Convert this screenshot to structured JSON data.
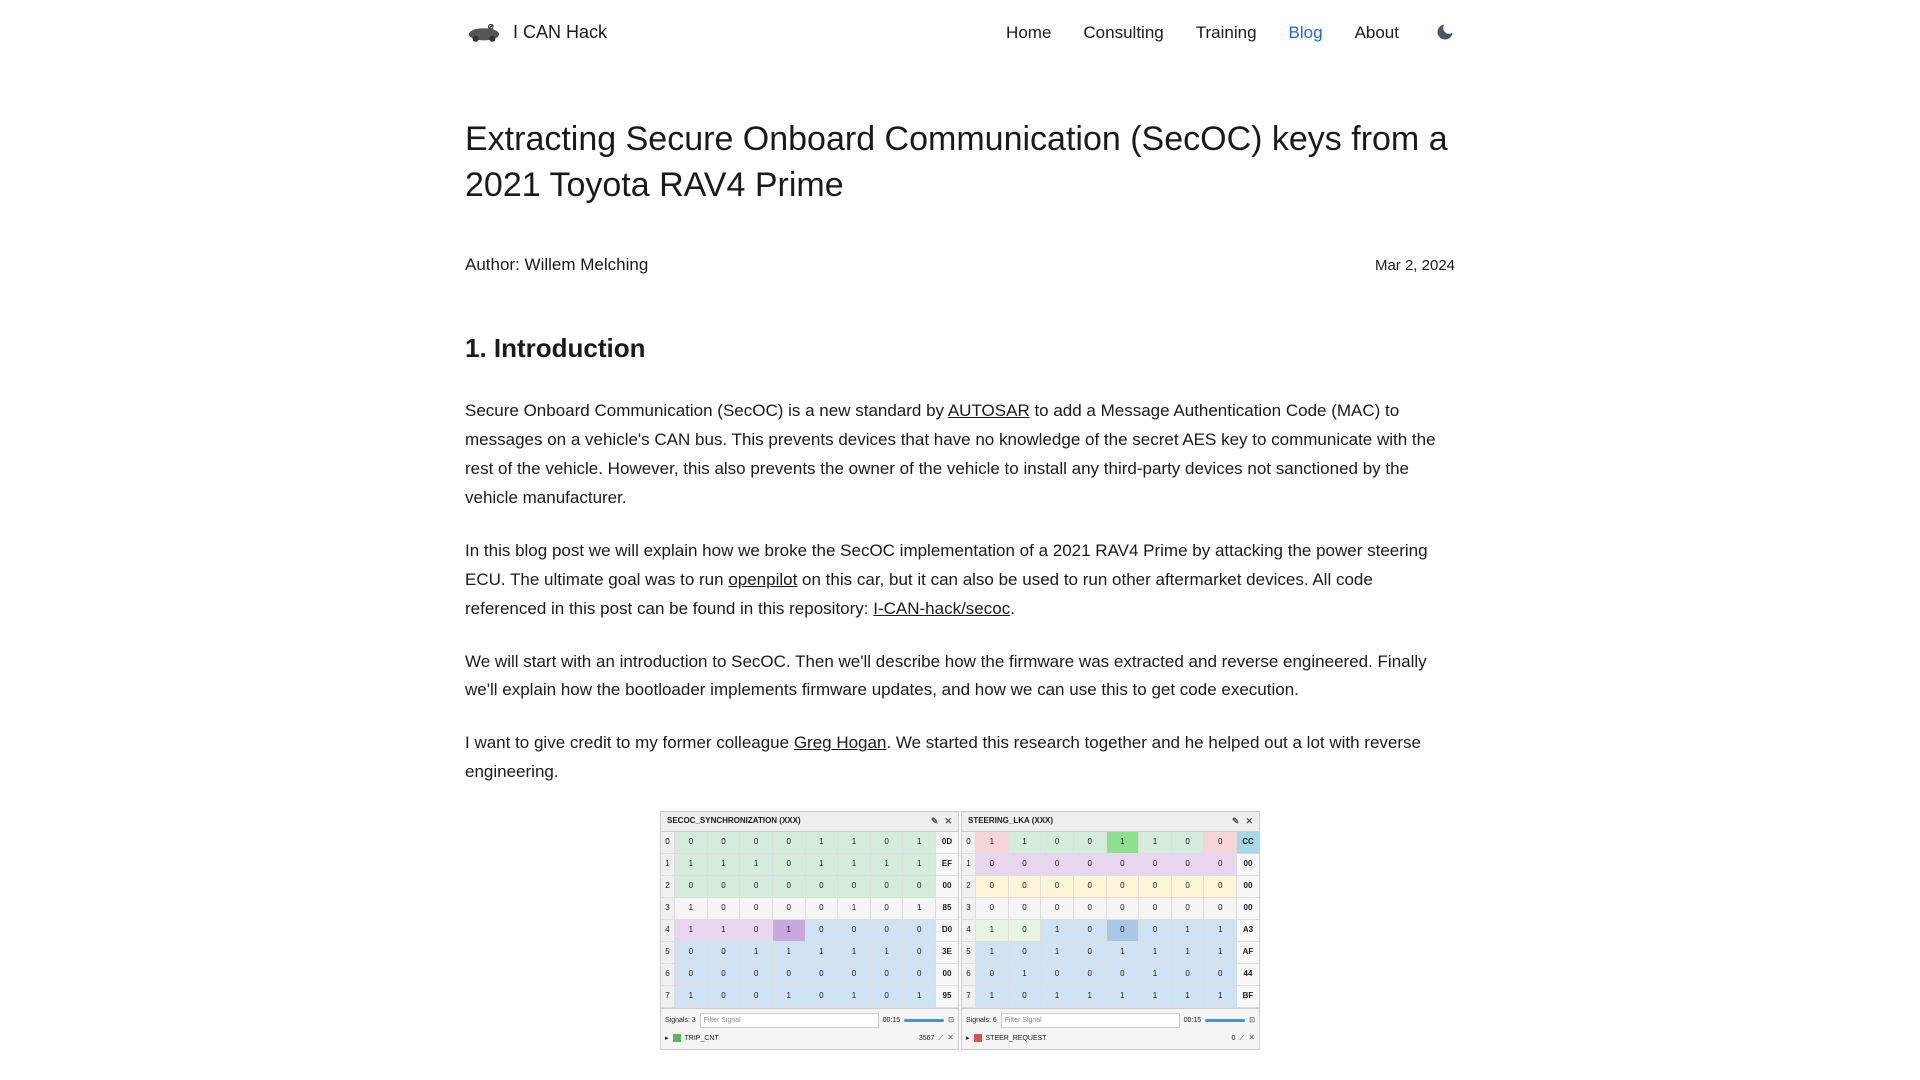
{
  "brand": "I CAN Hack",
  "nav": {
    "home": "Home",
    "consulting": "Consulting",
    "training": "Training",
    "blog": "Blog",
    "about": "About"
  },
  "article": {
    "title": "Extracting Secure Onboard Communication (SecOC) keys from a 2021 Toyota RAV4 Prime",
    "author_label": "Author:",
    "author_name": "Willem Melching",
    "date": "Mar 2, 2024",
    "h2": "1. Introduction",
    "p1a": "Secure Onboard Communication (SecOC) is a new standard by ",
    "p1_link1": "AUTOSAR",
    "p1b": " to add a Message Authentication Code (MAC) to messages on a vehicle's CAN bus. This prevents devices that have no knowledge of the secret AES key to communicate with the rest of the vehicle. However, this also prevents the owner of the vehicle to install any third-party devices not sanctioned by the vehicle manufacturer.",
    "p2a": "In this blog post we will explain how we broke the SecOC implementation of a 2021 RAV4 Prime by attacking the power steering ECU. The ultimate goal was to run ",
    "p2_link1": "openpilot",
    "p2b": " on this car, but it can also be used to run other aftermarket devices. All code referenced in this post can be found in this repository: ",
    "p2_link2": "I-CAN-hack/secoc",
    "p2c": ".",
    "p3": "We will start with an introduction to SecOC. Then we'll describe how the firmware was extracted and reverse engineered. Finally we'll explain how the bootloader implements firmware updates, and how we can use this to get code execution.",
    "p4a": "I want to give credit to my former colleague ",
    "p4_link1": "Greg Hogan",
    "p4b": ". We started this research together and he helped out a lot with reverse engineering."
  },
  "fig": {
    "panel1": {
      "title": "SECOC_SYNCHRONIZATION (XXX)",
      "rows": [
        {
          "idx": "0",
          "bits": [
            "0",
            "0",
            "0",
            "0",
            "1",
            "1",
            "0",
            "1"
          ],
          "hex": "0D",
          "cls": [
            "bg-green",
            "bg-green",
            "bg-green",
            "bg-green",
            "bg-green",
            "bg-green",
            "bg-green",
            "bg-green"
          ]
        },
        {
          "idx": "1",
          "bits": [
            "1",
            "1",
            "1",
            "0",
            "1",
            "1",
            "1",
            "1"
          ],
          "hex": "EF",
          "cls": [
            "bg-green",
            "bg-green",
            "bg-green",
            "bg-green",
            "bg-green",
            "bg-green",
            "bg-green",
            "bg-green"
          ]
        },
        {
          "idx": "2",
          "bits": [
            "0",
            "0",
            "0",
            "0",
            "0",
            "0",
            "0",
            "0"
          ],
          "hex": "00",
          "cls": [
            "bg-green",
            "bg-green",
            "bg-green",
            "bg-green",
            "bg-green",
            "bg-green",
            "bg-green",
            "bg-green"
          ]
        },
        {
          "idx": "3",
          "bits": [
            "1",
            "0",
            "0",
            "0",
            "0",
            "1",
            "0",
            "1"
          ],
          "hex": "85",
          "cls": [
            "",
            "",
            "",
            "",
            "",
            "",
            "",
            ""
          ]
        },
        {
          "idx": "4",
          "bits": [
            "1",
            "1",
            "0",
            "1",
            "0",
            "0",
            "0",
            "0"
          ],
          "hex": "D0",
          "cls": [
            "bg-purple",
            "bg-purple",
            "bg-purple",
            "bg-purple-bright",
            "bg-blue",
            "bg-blue",
            "bg-blue",
            "bg-blue"
          ]
        },
        {
          "idx": "5",
          "bits": [
            "0",
            "0",
            "1",
            "1",
            "1",
            "1",
            "1",
            "0"
          ],
          "hex": "3E",
          "cls": [
            "bg-blue",
            "bg-blue",
            "bg-blue",
            "bg-blue",
            "bg-blue",
            "bg-blue",
            "bg-blue",
            "bg-blue"
          ]
        },
        {
          "idx": "6",
          "bits": [
            "0",
            "0",
            "0",
            "0",
            "0",
            "0",
            "0",
            "0"
          ],
          "hex": "00",
          "cls": [
            "bg-blue",
            "bg-blue",
            "bg-blue",
            "bg-blue",
            "bg-blue",
            "bg-blue",
            "bg-blue",
            "bg-blue"
          ]
        },
        {
          "idx": "7",
          "bits": [
            "1",
            "0",
            "0",
            "1",
            "0",
            "1",
            "0",
            "1"
          ],
          "hex": "95",
          "cls": [
            "bg-blue",
            "bg-blue",
            "bg-blue",
            "bg-blue",
            "bg-blue",
            "bg-blue",
            "bg-blue",
            "bg-blue"
          ]
        }
      ],
      "signals_label": "Signals: 3",
      "filter_placeholder": "Filter Signal",
      "time": "00:15",
      "sig_name": "TRIP_CNT",
      "sig_val": "3567"
    },
    "panel2": {
      "title": "STEERING_LKA (XXX)",
      "rows": [
        {
          "idx": "0",
          "bits": [
            "1",
            "1",
            "0",
            "0",
            "1",
            "1",
            "0",
            "0"
          ],
          "hex": "CC",
          "cls": [
            "bg-pink",
            "bg-green",
            "bg-green",
            "bg-green",
            "bg-green-bright",
            "bg-green",
            "bg-green",
            "bg-pink"
          ],
          "hexcls": "bg-cyan"
        },
        {
          "idx": "1",
          "bits": [
            "0",
            "0",
            "0",
            "0",
            "0",
            "0",
            "0",
            "0"
          ],
          "hex": "00",
          "cls": [
            "bg-purple",
            "bg-purple",
            "bg-purple",
            "bg-purple",
            "bg-purple",
            "bg-purple",
            "bg-purple",
            "bg-purple"
          ]
        },
        {
          "idx": "2",
          "bits": [
            "0",
            "0",
            "0",
            "0",
            "0",
            "0",
            "0",
            "0"
          ],
          "hex": "00",
          "cls": [
            "bg-yellow",
            "bg-yellow",
            "bg-yellow",
            "bg-yellow",
            "bg-yellow",
            "bg-yellow",
            "bg-yellow",
            "bg-yellow"
          ]
        },
        {
          "idx": "3",
          "bits": [
            "0",
            "0",
            "0",
            "0",
            "0",
            "0",
            "0",
            "0"
          ],
          "hex": "00",
          "cls": [
            "",
            "",
            "",
            "",
            "",
            "",
            "",
            ""
          ]
        },
        {
          "idx": "4",
          "bits": [
            "1",
            "0",
            "1",
            "0",
            "0",
            "0",
            "1",
            "1"
          ],
          "hex": "A3",
          "cls": [
            "bg-pale-green",
            "bg-pale-green",
            "bg-blue",
            "bg-blue",
            "bg-blue-bright",
            "bg-blue",
            "bg-blue",
            "bg-blue"
          ]
        },
        {
          "idx": "5",
          "bits": [
            "1",
            "0",
            "1",
            "0",
            "1",
            "1",
            "1",
            "1"
          ],
          "hex": "AF",
          "cls": [
            "bg-blue",
            "bg-blue",
            "bg-blue",
            "bg-blue",
            "bg-blue",
            "bg-blue",
            "bg-blue",
            "bg-blue"
          ]
        },
        {
          "idx": "6",
          "bits": [
            "0",
            "1",
            "0",
            "0",
            "0",
            "1",
            "0",
            "0"
          ],
          "hex": "44",
          "cls": [
            "bg-blue",
            "bg-blue",
            "bg-blue",
            "bg-blue",
            "bg-blue",
            "bg-blue",
            "bg-blue",
            "bg-blue"
          ]
        },
        {
          "idx": "7",
          "bits": [
            "1",
            "0",
            "1",
            "1",
            "1",
            "1",
            "1",
            "1"
          ],
          "hex": "BF",
          "cls": [
            "bg-blue",
            "bg-blue",
            "bg-blue",
            "bg-blue",
            "bg-blue",
            "bg-blue",
            "bg-blue",
            "bg-blue"
          ]
        }
      ],
      "signals_label": "Signals: 6",
      "filter_placeholder": "Filter Signal",
      "time": "00:15",
      "sig_name": "STEER_REQUEST",
      "sig_val": "0"
    }
  }
}
